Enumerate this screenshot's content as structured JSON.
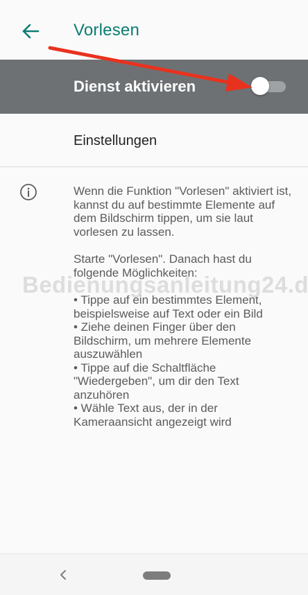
{
  "app_bar": {
    "title": "Vorlesen",
    "back_icon": "arrow-left-icon",
    "accent_color": "#0b7d72"
  },
  "service_toggle": {
    "label": "Dienst aktivieren",
    "state": "off",
    "row_color": "#6d7174"
  },
  "settings": {
    "label": "Einstellungen"
  },
  "info": {
    "icon": "info-icon",
    "paragraph1": "Wenn die Funktion \"Vorlesen\" aktiviert ist, kannst du auf bestimmte Elemente auf dem Bildschirm tippen, um sie laut vorlesen zu lassen.",
    "paragraph2": "Starte \"Vorlesen\". Danach hast du folgende Möglichkeiten:",
    "bullets": [
      "• Tippe auf ein bestimmtes Element, beispielsweise auf Text oder ein Bild",
      "• Ziehe deinen Finger über den Bildschirm, um mehrere Elemente auszuwählen",
      "• Tippe auf die Schaltfläche \"Wiedergeben\", um dir den Text anzuhören",
      "• Wähle Text aus, der in der Kameraansicht angezeigt wird"
    ]
  },
  "watermark": "Bedienungsanleitung24.de",
  "annotation": {
    "arrow_color": "#e8321e"
  },
  "nav_bar": {
    "back_icon": "chevron-left-icon",
    "home_icon": "home-pill-icon"
  }
}
